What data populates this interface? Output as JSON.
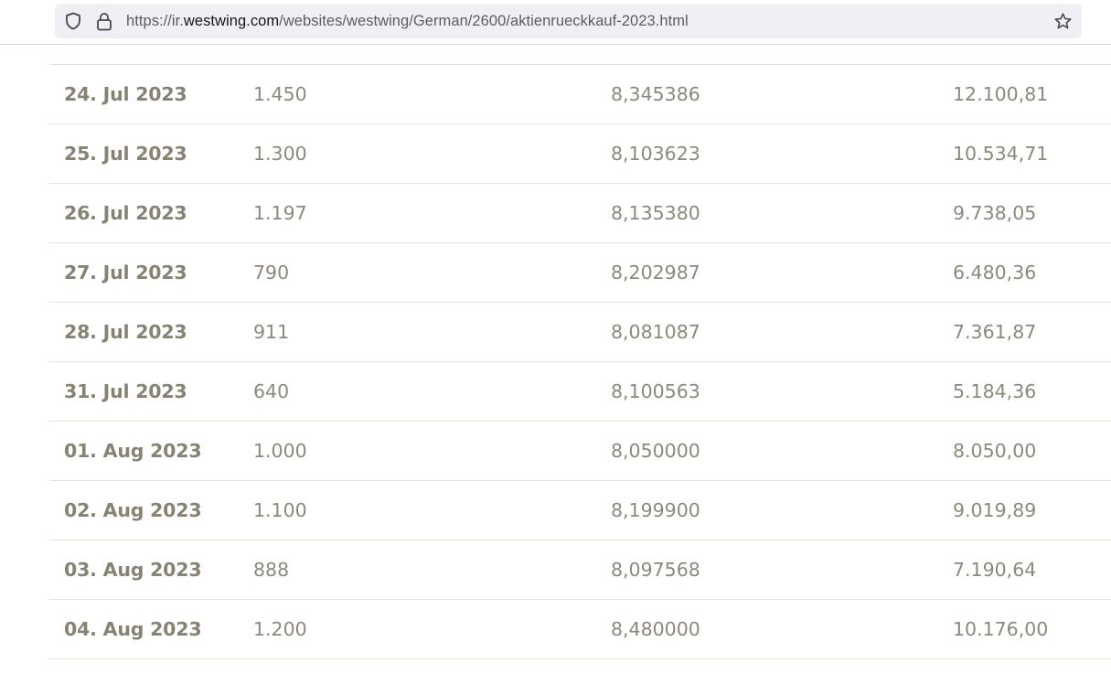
{
  "browser": {
    "url_prefix": "https://ir.",
    "url_domain": "westwing.com",
    "url_path": "/websites/westwing/German/2600/aktienrueckkauf-2023.html",
    "icons": [
      "shield-icon",
      "lock-icon",
      "star-icon"
    ]
  },
  "table": {
    "partial_row": [
      "",
      "",
      ",",
      ","
    ],
    "rows": [
      {
        "date": "24. Jul 2023",
        "shares": "1.450",
        "avg_price": "8,345386",
        "volume": "12.100,81"
      },
      {
        "date": "25. Jul 2023",
        "shares": "1.300",
        "avg_price": "8,103623",
        "volume": "10.534,71"
      },
      {
        "date": "26. Jul 2023",
        "shares": "1.197",
        "avg_price": "8,135380",
        "volume": "9.738,05"
      },
      {
        "date": "27. Jul 2023",
        "shares": "790",
        "avg_price": "8,202987",
        "volume": "6.480,36"
      },
      {
        "date": "28. Jul 2023",
        "shares": "911",
        "avg_price": "8,081087",
        "volume": "7.361,87"
      },
      {
        "date": "31. Jul 2023",
        "shares": "640",
        "avg_price": "8,100563",
        "volume": "5.184,36"
      },
      {
        "date": "01. Aug 2023",
        "shares": "1.000",
        "avg_price": "8,050000",
        "volume": "8.050,00"
      },
      {
        "date": "02. Aug 2023",
        "shares": "1.100",
        "avg_price": "8,199900",
        "volume": "9.019,89"
      },
      {
        "date": "03. Aug 2023",
        "shares": "888",
        "avg_price": "8,097568",
        "volume": "7.190,64"
      },
      {
        "date": "04. Aug 2023",
        "shares": "1.200",
        "avg_price": "8,480000",
        "volume": "10.176,00"
      }
    ]
  }
}
